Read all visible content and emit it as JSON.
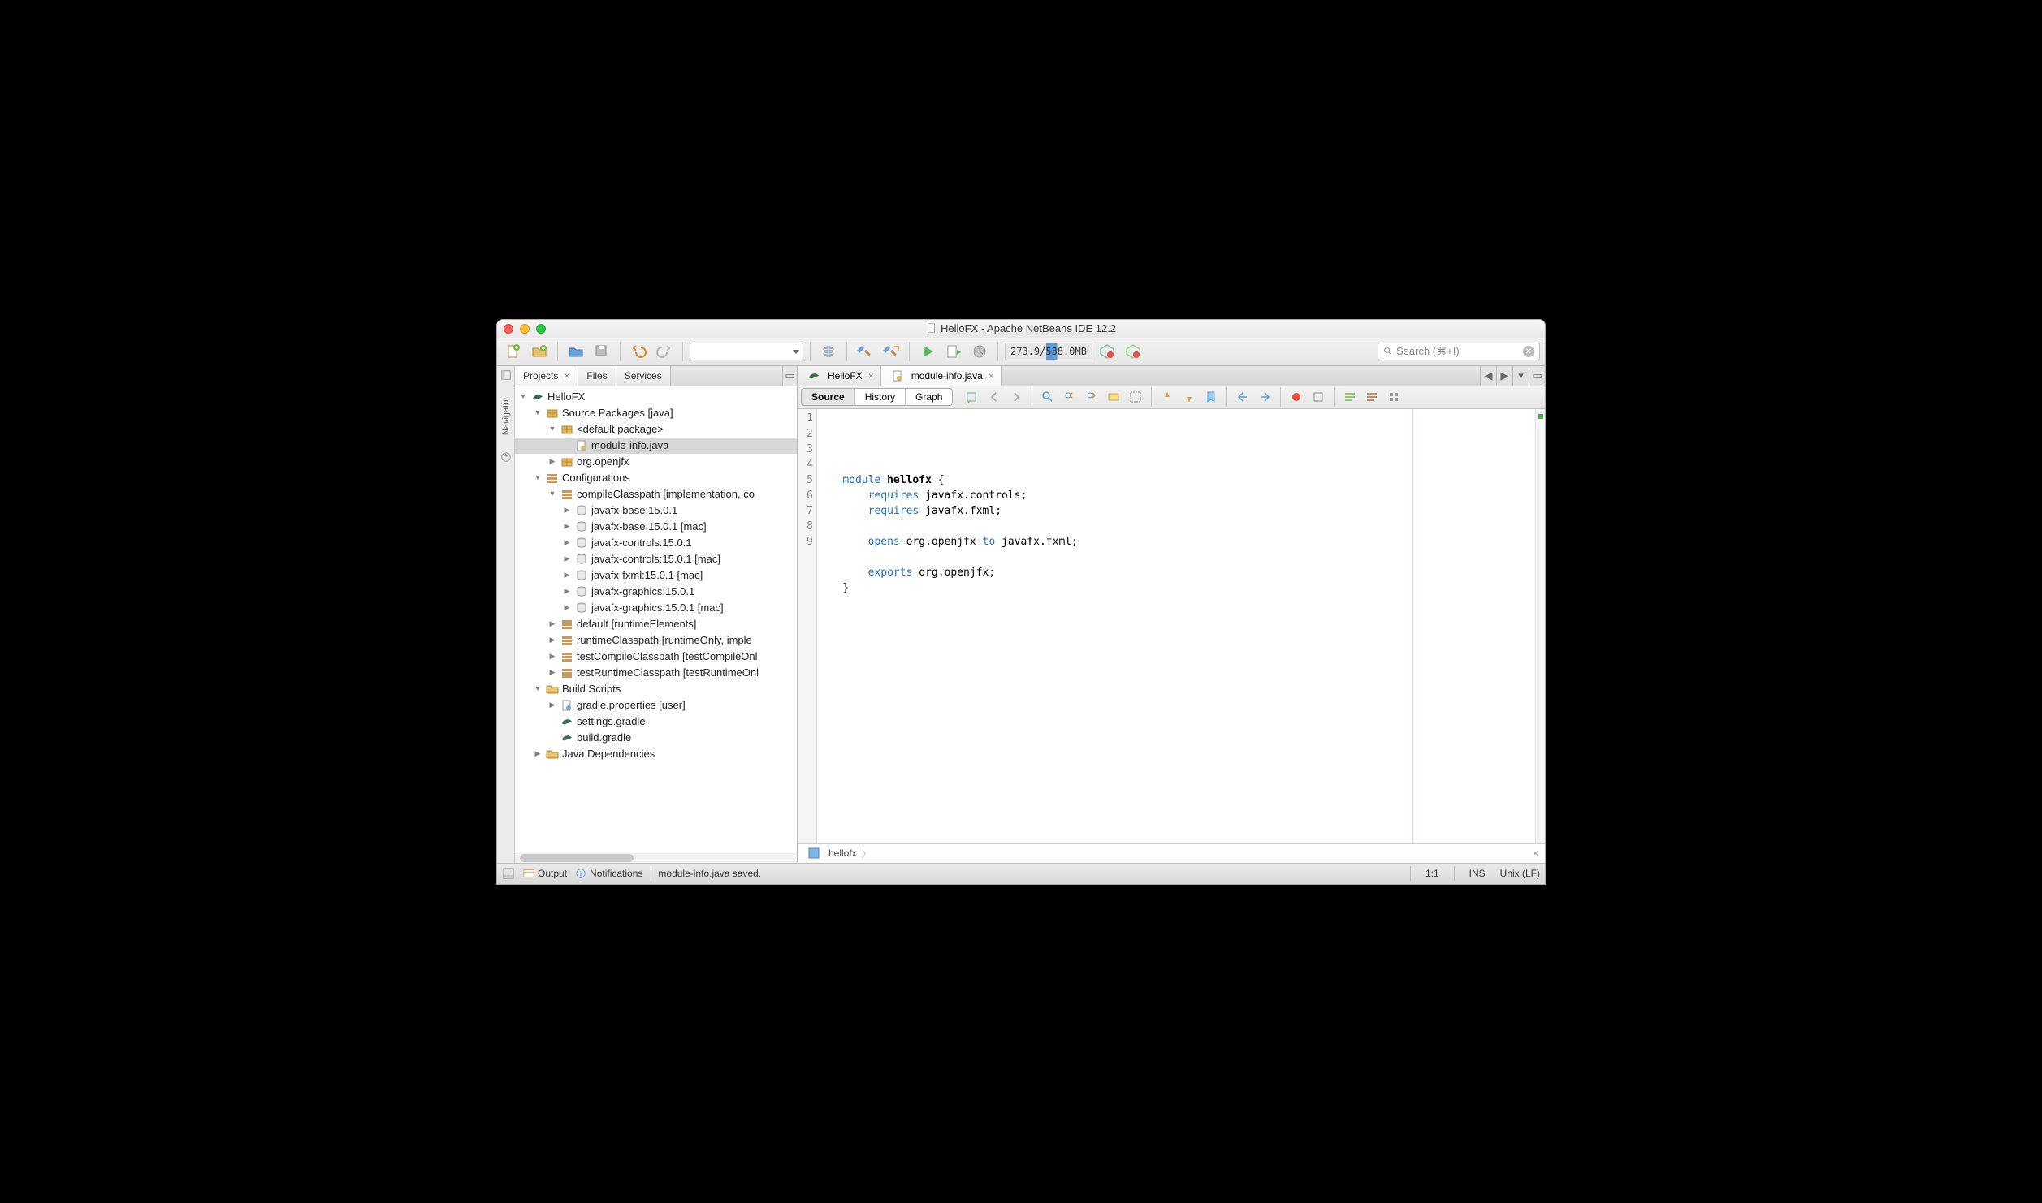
{
  "window": {
    "title": "HelloFX - Apache NetBeans IDE 12.2"
  },
  "toolbar": {
    "memory": "273.9/538.0MB",
    "search_placeholder": "Search (⌘+I)"
  },
  "nav_sidebar_label": "Navigator",
  "left_panel": {
    "tabs": [
      {
        "label": "Projects",
        "active": true,
        "closable": true
      },
      {
        "label": "Files",
        "active": false,
        "closable": false
      },
      {
        "label": "Services",
        "active": false,
        "closable": false
      }
    ],
    "tree": {
      "project": "HelloFX",
      "source_packages_label": "Source Packages [java]",
      "default_package_label": "<default package>",
      "module_info_file": "module-info.java",
      "org_openjfx_label": "org.openjfx",
      "configurations_label": "Configurations",
      "compileClasspath_label": "compileClasspath [implementation, co",
      "deps": [
        "javafx-base:15.0.1",
        "javafx-base:15.0.1 [mac]",
        "javafx-controls:15.0.1",
        "javafx-controls:15.0.1 [mac]",
        "javafx-fxml:15.0.1 [mac]",
        "javafx-graphics:15.0.1",
        "javafx-graphics:15.0.1 [mac]"
      ],
      "other_configs": [
        "default [runtimeElements]",
        "runtimeClasspath [runtimeOnly, imple",
        "testCompileClasspath [testCompileOnl",
        "testRuntimeClasspath [testRuntimeOnl"
      ],
      "build_scripts_label": "Build Scripts",
      "build_scripts": [
        "gradle.properties [user]",
        "settings.gradle",
        "build.gradle"
      ],
      "java_deps_label": "Java Dependencies"
    }
  },
  "editor": {
    "tabs": [
      {
        "label": "HelloFX",
        "active": false
      },
      {
        "label": "module-info.java",
        "active": true
      }
    ],
    "view_tabs": {
      "source": "Source",
      "history": "History",
      "graph": "Graph"
    },
    "code_lines": [
      {
        "n": 1,
        "pre": "    ",
        "kw": "module",
        "mid": " ",
        "bold": "hellofx",
        "rest": " {"
      },
      {
        "n": 2,
        "pre": "        ",
        "kw": "requires",
        "mid": " javafx.controls;",
        "bold": "",
        "rest": ""
      },
      {
        "n": 3,
        "pre": "        ",
        "kw": "requires",
        "mid": " javafx.fxml;",
        "bold": "",
        "rest": ""
      },
      {
        "n": 4,
        "pre": "",
        "kw": "",
        "mid": "",
        "bold": "",
        "rest": ""
      },
      {
        "n": 5,
        "pre": "        ",
        "kw": "opens",
        "mid": " org.openjfx ",
        "kw2": "to",
        "rest": " javafx.fxml;"
      },
      {
        "n": 6,
        "pre": "",
        "kw": "",
        "mid": "",
        "bold": "",
        "rest": ""
      },
      {
        "n": 7,
        "pre": "        ",
        "kw": "exports",
        "mid": " org.openjfx;",
        "bold": "",
        "rest": ""
      },
      {
        "n": 8,
        "pre": "    }",
        "kw": "",
        "mid": "",
        "bold": "",
        "rest": ""
      },
      {
        "n": 9,
        "pre": "",
        "kw": "",
        "mid": "",
        "bold": "",
        "rest": ""
      }
    ],
    "breadcrumb": "hellofx"
  },
  "statusbar": {
    "output_label": "Output",
    "notifications_label": "Notifications",
    "save_msg": "module-info.java saved.",
    "cursor": "1:1",
    "mode": "INS",
    "encoding": "Unix (LF)"
  }
}
